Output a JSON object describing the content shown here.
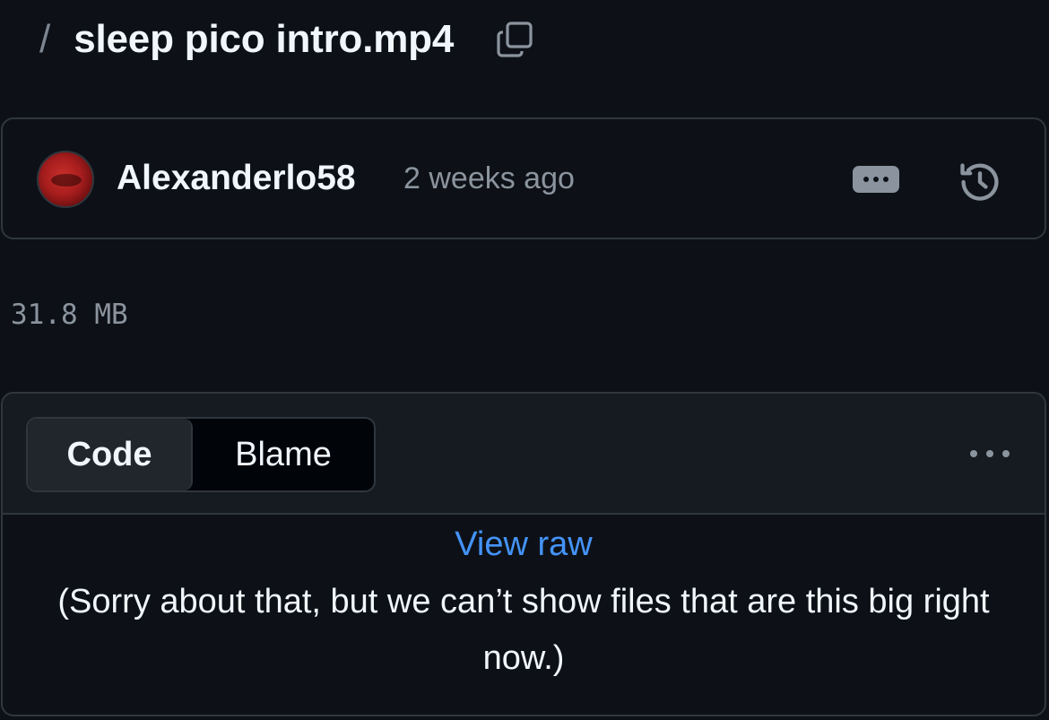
{
  "breadcrumb": {
    "separator": "/",
    "file_name": "sleep pico intro.mp4",
    "copy_icon": "copy-icon"
  },
  "commit": {
    "author": "Alexanderlo58",
    "time": "2 weeks ago",
    "more_icon": "ellipsis-icon",
    "history_icon": "history-icon"
  },
  "file": {
    "size": "31.8 MB",
    "tabs": [
      {
        "label": "Code",
        "selected": true
      },
      {
        "label": "Blame",
        "selected": false
      }
    ],
    "menu_icon": "kebab-horizontal-icon",
    "view_raw": "View raw",
    "message": "(Sorry about that, but we can’t show files that are this big right now.)"
  },
  "colors": {
    "background": "#0d1117",
    "border": "#30363d",
    "link": "#4493f8",
    "muted": "#8b949e"
  }
}
